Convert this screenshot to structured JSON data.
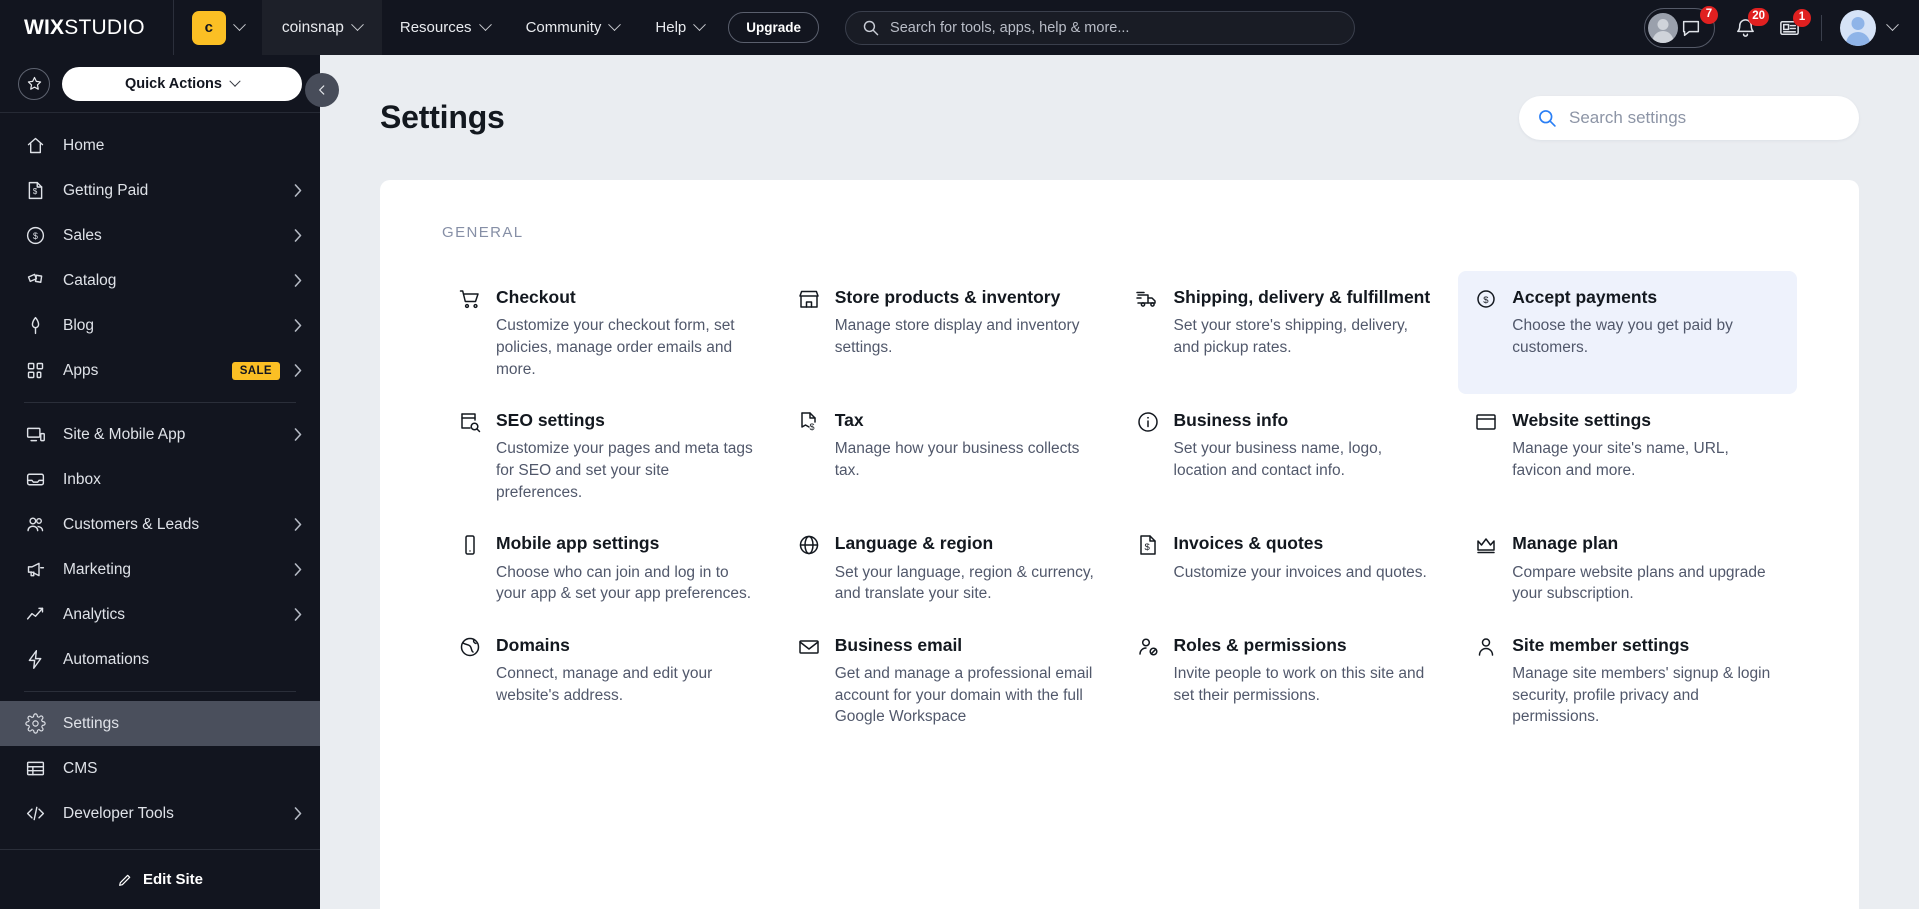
{
  "topbar": {
    "brand_bold": "WIX",
    "brand_light": "STUDIO",
    "site_initial": "c",
    "site_name": "coinsnap",
    "menu": [
      {
        "label": "Resources"
      },
      {
        "label": "Community"
      },
      {
        "label": "Help"
      }
    ],
    "upgrade_label": "Upgrade",
    "search_placeholder": "Search for tools, apps, help & more...",
    "search_value": "",
    "badges": {
      "chat": "7",
      "notifications": "20",
      "news": "1"
    }
  },
  "sidebar": {
    "quick_actions_label": "Quick Actions",
    "edit_site_label": "Edit Site",
    "items": [
      {
        "label": "Home",
        "icon": "home-icon",
        "arrow": false,
        "badge": "",
        "active": false
      },
      {
        "label": "Getting Paid",
        "icon": "invoice-icon",
        "arrow": true,
        "badge": "",
        "active": false
      },
      {
        "label": "Sales",
        "icon": "coin-icon",
        "arrow": true,
        "badge": "",
        "active": false
      },
      {
        "label": "Catalog",
        "icon": "catalog-icon",
        "arrow": true,
        "badge": "",
        "active": false
      },
      {
        "label": "Blog",
        "icon": "pen-icon",
        "arrow": true,
        "badge": "",
        "active": false
      },
      {
        "label": "Apps",
        "icon": "apps-icon",
        "arrow": true,
        "badge": "SALE",
        "active": false
      },
      {
        "label": "Site & Mobile App",
        "icon": "devices-icon",
        "arrow": true,
        "badge": "",
        "active": false,
        "divider_before": true
      },
      {
        "label": "Inbox",
        "icon": "inbox-icon",
        "arrow": false,
        "badge": "",
        "active": false
      },
      {
        "label": "Customers & Leads",
        "icon": "people-icon",
        "arrow": true,
        "badge": "",
        "active": false
      },
      {
        "label": "Marketing",
        "icon": "megaphone-icon",
        "arrow": true,
        "badge": "",
        "active": false
      },
      {
        "label": "Analytics",
        "icon": "chart-icon",
        "arrow": true,
        "badge": "",
        "active": false
      },
      {
        "label": "Automations",
        "icon": "bolt-icon",
        "arrow": false,
        "badge": "",
        "active": false
      },
      {
        "label": "Settings",
        "icon": "gear-icon",
        "arrow": false,
        "badge": "",
        "active": true,
        "divider_before": true
      },
      {
        "label": "CMS",
        "icon": "table-icon",
        "arrow": false,
        "badge": "",
        "active": false
      },
      {
        "label": "Developer Tools",
        "icon": "code-icon",
        "arrow": true,
        "badge": "",
        "active": false
      }
    ]
  },
  "main": {
    "page_title": "Settings",
    "search_placeholder": "Search settings",
    "search_value": "",
    "section_title": "GENERAL",
    "cards": [
      {
        "title": "Checkout",
        "desc": "Customize your checkout form, set policies, manage order emails and more.",
        "icon": "cart-icon",
        "highlight": false
      },
      {
        "title": "Store products & inventory",
        "desc": "Manage store display and inventory settings.",
        "icon": "store-icon",
        "highlight": false
      },
      {
        "title": "Shipping, delivery & fulfillment",
        "desc": "Set your store's shipping, delivery, and pickup rates.",
        "icon": "truck-icon",
        "highlight": false
      },
      {
        "title": "Accept payments",
        "desc": "Choose the way you get paid by customers.",
        "icon": "coin-dollar-icon",
        "highlight": true
      },
      {
        "title": "SEO settings",
        "desc": "Customize your pages and meta tags for SEO and set your site preferences.",
        "icon": "seo-icon",
        "highlight": false
      },
      {
        "title": "Tax",
        "desc": "Manage how your business collects tax.",
        "icon": "tax-icon",
        "highlight": false
      },
      {
        "title": "Business info",
        "desc": "Set your business name, logo, location and contact info.",
        "icon": "info-icon",
        "highlight": false
      },
      {
        "title": "Website settings",
        "desc": "Manage your site's name, URL, favicon and more.",
        "icon": "browser-icon",
        "highlight": false
      },
      {
        "title": "Mobile app settings",
        "desc": "Choose who can join and log in to your app & set your app preferences.",
        "icon": "phone-icon",
        "highlight": false
      },
      {
        "title": "Language & region",
        "desc": "Set your language, region & currency, and translate your site.",
        "icon": "globe-icon",
        "highlight": false
      },
      {
        "title": "Invoices & quotes",
        "desc": "Customize your invoices and quotes.",
        "icon": "invoice-doc-icon",
        "highlight": false
      },
      {
        "title": "Manage plan",
        "desc": "Compare website plans and upgrade your subscription.",
        "icon": "crown-icon",
        "highlight": false
      },
      {
        "title": "Domains",
        "desc": "Connect, manage and edit your website's address.",
        "icon": "domain-globe-icon",
        "highlight": false
      },
      {
        "title": "Business email",
        "desc": "Get and manage a professional email account for your domain with the full Google Workspace",
        "icon": "mail-icon",
        "highlight": false
      },
      {
        "title": "Roles & permissions",
        "desc": "Invite people to work on this site and set their permissions.",
        "icon": "person-block-icon",
        "highlight": false
      },
      {
        "title": "Site member settings",
        "desc": "Manage site members' signup & login security, profile privacy and permissions.",
        "icon": "person-icon",
        "highlight": false
      }
    ]
  },
  "colors": {
    "topbar_bg": "#12151f",
    "sidebar_bg": "#12151f",
    "accent_yellow": "#fbbf24",
    "badge_red": "#e02020",
    "highlight_card": "#eef2fc",
    "page_bg": "#eaedf1",
    "search_icon_blue": "#2b7ff5"
  }
}
